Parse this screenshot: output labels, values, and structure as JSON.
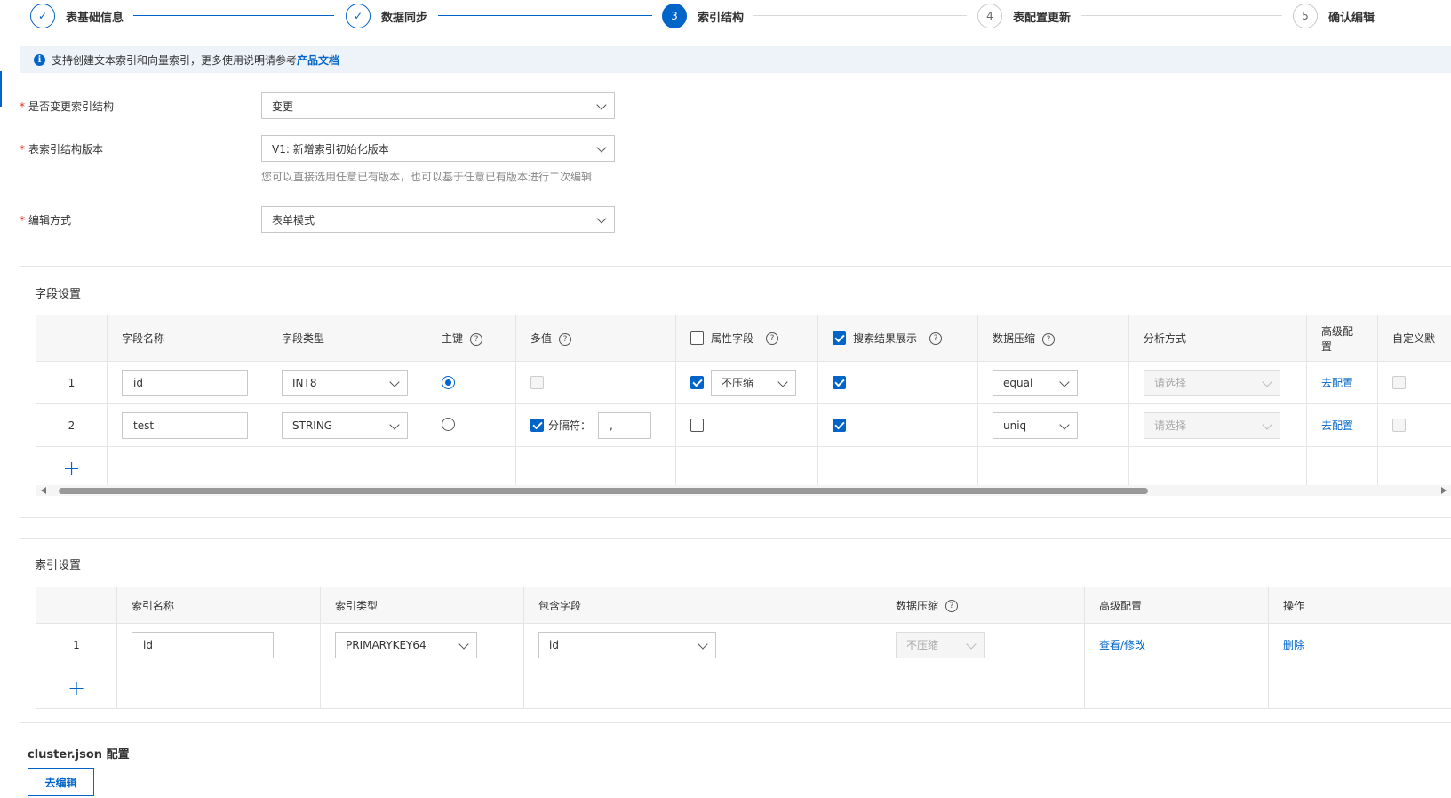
{
  "steps": [
    {
      "index": "1",
      "label": "表基础信息",
      "status": "done"
    },
    {
      "index": "2",
      "label": "数据同步",
      "status": "done"
    },
    {
      "index": "3",
      "label": "索引结构",
      "status": "active"
    },
    {
      "index": "4",
      "label": "表配置更新",
      "status": "wait"
    },
    {
      "index": "5",
      "label": "确认编辑",
      "status": "wait"
    }
  ],
  "info": {
    "text": "支持创建文本索引和向量索引，更多使用说明请参考",
    "link": "产品文档"
  },
  "form": {
    "change_structure": {
      "label": "是否变更索引结构",
      "value": "变更"
    },
    "version": {
      "label": "表索引结构版本",
      "value": "V1: 新增索引初始化版本",
      "hint": "您可以直接选用任意已有版本，也可以基于任意已有版本进行二次编辑"
    },
    "edit_mode": {
      "label": "编辑方式",
      "value": "表单模式"
    }
  },
  "fields": {
    "title": "字段设置",
    "headers": {
      "name": "字段名称",
      "type": "字段类型",
      "primary_key": "主键",
      "multi_value": "多值",
      "attribute": "属性字段",
      "search_display": "搜索结果展示",
      "compression": "数据压缩",
      "analyzer": "分析方式",
      "advanced": "高级配置",
      "custom_default": "自定义默"
    },
    "rows": [
      {
        "num": "1",
        "name": "id",
        "type": "INT8",
        "attr_compress": "不压缩",
        "compression": "equal",
        "analyzer": "请选择",
        "advanced": "去配置"
      },
      {
        "num": "2",
        "name": "test",
        "type": "STRING",
        "separator_label": "分隔符：",
        "separator": ",",
        "compression": "uniq",
        "analyzer": "请选择",
        "advanced": "去配置"
      }
    ],
    "add": "+"
  },
  "indexes": {
    "title": "索引设置",
    "headers": {
      "name": "索引名称",
      "type": "索引类型",
      "fields": "包含字段",
      "compression": "数据压缩",
      "advanced": "高级配置",
      "actions": "操作"
    },
    "rows": [
      {
        "num": "1",
        "name": "id",
        "type": "PRIMARYKEY64",
        "fields": "id",
        "compression": "不压缩",
        "advanced": "查看/修改",
        "action": "删除"
      }
    ],
    "add": "+"
  },
  "cluster": {
    "title": "cluster.json 配置",
    "button": "去编辑"
  },
  "colors": {
    "primary": "#0064c8",
    "required": "#d93026"
  }
}
